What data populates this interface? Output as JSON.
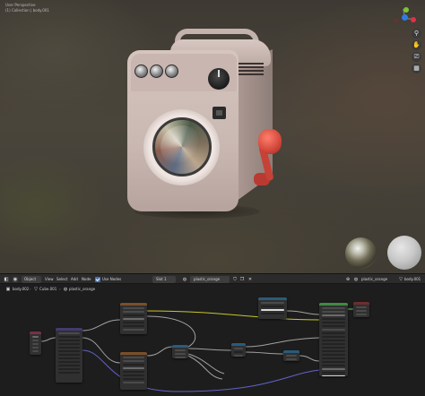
{
  "viewport": {
    "mode_label": "User Perspective",
    "collection_label": "(1) Collection | body.001",
    "tools": [
      "zoom-icon",
      "hand-icon",
      "camera-icon",
      "grid-icon"
    ],
    "tool_glyphs": [
      "⚲",
      "✋",
      "⎚",
      "▦"
    ],
    "gizmo_axes": {
      "x": "#e0304a",
      "y": "#7cc42f",
      "z": "#2f7ce0"
    }
  },
  "editor_header": {
    "editor_type": "",
    "object_mode": "Object",
    "menu": [
      "View",
      "Select",
      "Add",
      "Node"
    ],
    "use_nodes_label": "Use Nodes",
    "use_nodes_checked": true,
    "slot": "Slot 1",
    "material": "plastic_orange",
    "material_right": "plastic_orange",
    "object_name": "body.001"
  },
  "breadcrumb": [
    "body.002",
    "Cube.001",
    "plastic_orange"
  ],
  "colors": {
    "accent": "#4772b3",
    "wire_yellow": "#c7c729",
    "wire_grey": "#a1a1a1",
    "wire_purple": "#6363c7",
    "wire_green": "#63c763"
  }
}
